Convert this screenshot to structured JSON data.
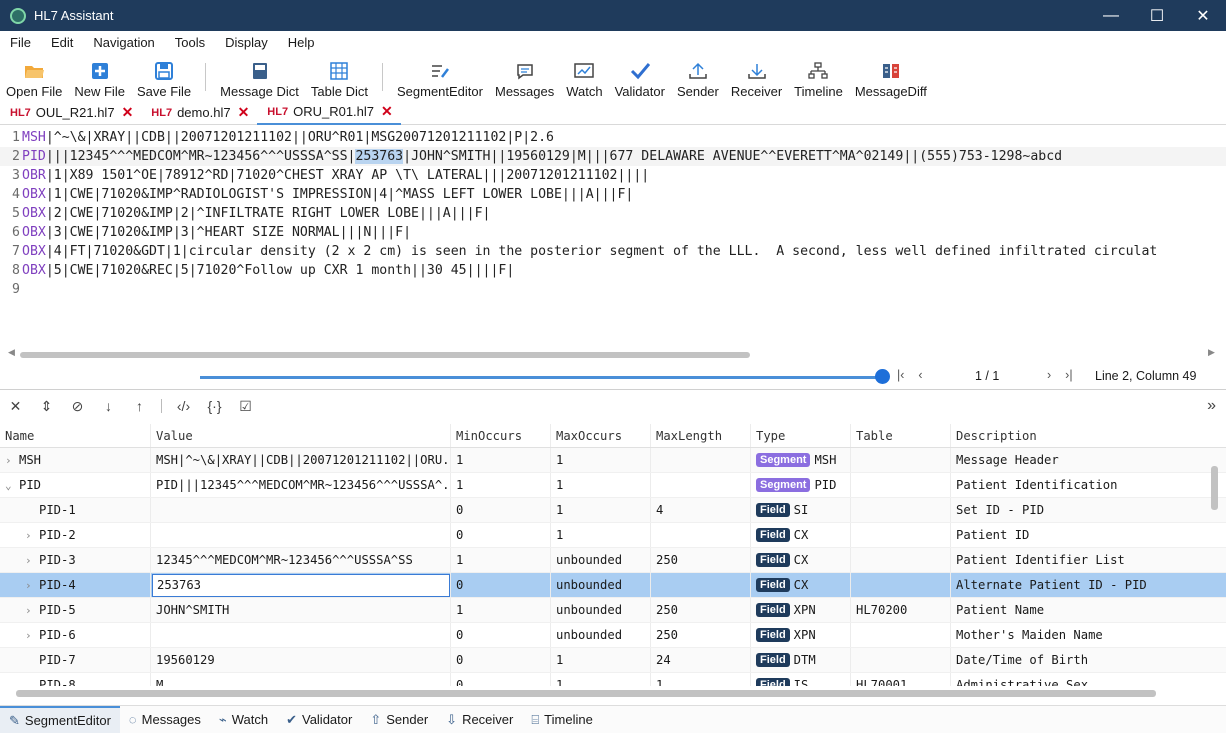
{
  "window": {
    "title": "HL7 Assistant",
    "controls": [
      "—",
      "☐",
      "✕"
    ]
  },
  "menu": [
    "File",
    "Edit",
    "Navigation",
    "Tools",
    "Display",
    "Help"
  ],
  "toolbar": {
    "open_file": "Open File",
    "new_file": "New File",
    "save_file": "Save File",
    "message_dict": "Message Dict",
    "table_dict": "Table Dict",
    "segment_editor": "SegmentEditor",
    "messages": "Messages",
    "watch": "Watch",
    "validator": "Validator",
    "sender": "Sender",
    "receiver": "Receiver",
    "timeline": "Timeline",
    "message_diff": "MessageDiff"
  },
  "tabs": [
    {
      "prefix": "HL7",
      "label": "OUL_R21.hl7"
    },
    {
      "prefix": "HL7",
      "label": "demo.hl7"
    },
    {
      "prefix": "HL7",
      "label": "ORU_R01.hl7"
    }
  ],
  "editor": {
    "lines": [
      {
        "num": "1",
        "seg": "MSH",
        "rest": "|^~\\&|XRAY||CDB||20071201211102||ORU^R01|MSG20071201211102|P|2.6"
      },
      {
        "num": "2",
        "seg": "PID",
        "pre": "|||12345^^^MEDCOM^MR~123456^^^USSSA^SS|",
        "sel": "253763",
        "post": "|JOHN^SMITH||19560129|M|||677 DELAWARE AVENUE^^EVERETT^MA^02149||(555)753-1298~abcd"
      },
      {
        "num": "3",
        "seg": "OBR",
        "rest": "|1|X89 1501^OE|78912^RD|71020^CHEST XRAY AP \\T\\ LATERAL|||20071201211102||||"
      },
      {
        "num": "4",
        "seg": "OBX",
        "rest": "|1|CWE|71020&IMP^RADIOLOGIST'S IMPRESSION|4|^MASS LEFT LOWER LOBE|||A|||F|"
      },
      {
        "num": "5",
        "seg": "OBX",
        "rest": "|2|CWE|71020&IMP|2|^INFILTRATE RIGHT LOWER LOBE|||A|||F|"
      },
      {
        "num": "6",
        "seg": "OBX",
        "rest": "|3|CWE|71020&IMP|3|^HEART SIZE NORMAL|||N|||F|"
      },
      {
        "num": "7",
        "seg": "OBX",
        "rest": "|4|FT|71020&GDT|1|circular density (2 x 2 cm) is seen in the posterior segment of the LLL.  A second, less well defined infiltrated circulat"
      },
      {
        "num": "8",
        "seg": "OBX",
        "rest": "|5|CWE|71020&REC|5|71020^Follow up CXR 1 month||30 45||||F|"
      },
      {
        "num": "9",
        "seg": "",
        "rest": ""
      }
    ]
  },
  "status": {
    "page": "1 / 1",
    "position": "Line 2, Column 49"
  },
  "grid": {
    "headers": [
      "Name",
      "Value",
      "MinOccurs",
      "MaxOccurs",
      "MaxLength",
      "Type",
      "Table",
      "Description"
    ],
    "rows": [
      {
        "chev": "›",
        "indent": 0,
        "name": "MSH",
        "value": "MSH|^~\\&|XRAY||CDB||20071201211102||ORU...",
        "min": "1",
        "max": "1",
        "len": "",
        "badge": "Segment",
        "type": "MSH",
        "table": "",
        "desc": "Message Header"
      },
      {
        "chev": "⌄",
        "indent": 0,
        "name": "PID",
        "value": "PID|||12345^^^MEDCOM^MR~123456^^^USSSA^...",
        "min": "1",
        "max": "1",
        "len": "",
        "badge": "Segment",
        "type": "PID",
        "table": "",
        "desc": "Patient Identification"
      },
      {
        "chev": "",
        "indent": 1,
        "name": "PID-1",
        "value": "",
        "min": "0",
        "max": "1",
        "len": "4",
        "badge": "Field",
        "type": "SI",
        "table": "",
        "desc": "Set ID - PID"
      },
      {
        "chev": "›",
        "indent": 1,
        "name": "PID-2",
        "value": "",
        "min": "0",
        "max": "1",
        "len": "",
        "badge": "Field",
        "type": "CX",
        "table": "",
        "desc": "Patient ID"
      },
      {
        "chev": "›",
        "indent": 1,
        "name": "PID-3",
        "value": "12345^^^MEDCOM^MR~123456^^^USSSA^SS",
        "min": "1",
        "max": "unbounded",
        "len": "250",
        "badge": "Field",
        "type": "CX",
        "table": "",
        "desc": "Patient Identifier List"
      },
      {
        "chev": "›",
        "indent": 1,
        "name": "PID-4",
        "value": "253763",
        "min": "0",
        "max": "unbounded",
        "len": "",
        "badge": "Field",
        "type": "CX",
        "table": "",
        "desc": "Alternate Patient ID - PID",
        "selected": true
      },
      {
        "chev": "›",
        "indent": 1,
        "name": "PID-5",
        "value": "JOHN^SMITH",
        "min": "1",
        "max": "unbounded",
        "len": "250",
        "badge": "Field",
        "type": "XPN",
        "table": "HL70200",
        "desc": "Patient Name"
      },
      {
        "chev": "›",
        "indent": 1,
        "name": "PID-6",
        "value": "",
        "min": "0",
        "max": "unbounded",
        "len": "250",
        "badge": "Field",
        "type": "XPN",
        "table": "",
        "desc": "Mother's Maiden Name"
      },
      {
        "chev": "",
        "indent": 1,
        "name": "PID-7",
        "value": "19560129",
        "min": "0",
        "max": "1",
        "len": "24",
        "badge": "Field",
        "type": "DTM",
        "table": "",
        "desc": "Date/Time of Birth"
      },
      {
        "chev": "",
        "indent": 1,
        "name": "PID-8",
        "value": "M",
        "min": "0",
        "max": "1",
        "len": "1",
        "badge": "Field",
        "type": "IS",
        "table": "HL70001",
        "desc": "Administrative Sex"
      }
    ]
  },
  "bottom_tabs": [
    "SegmentEditor",
    "Messages",
    "Watch",
    "Validator",
    "Sender",
    "Receiver",
    "Timeline"
  ]
}
